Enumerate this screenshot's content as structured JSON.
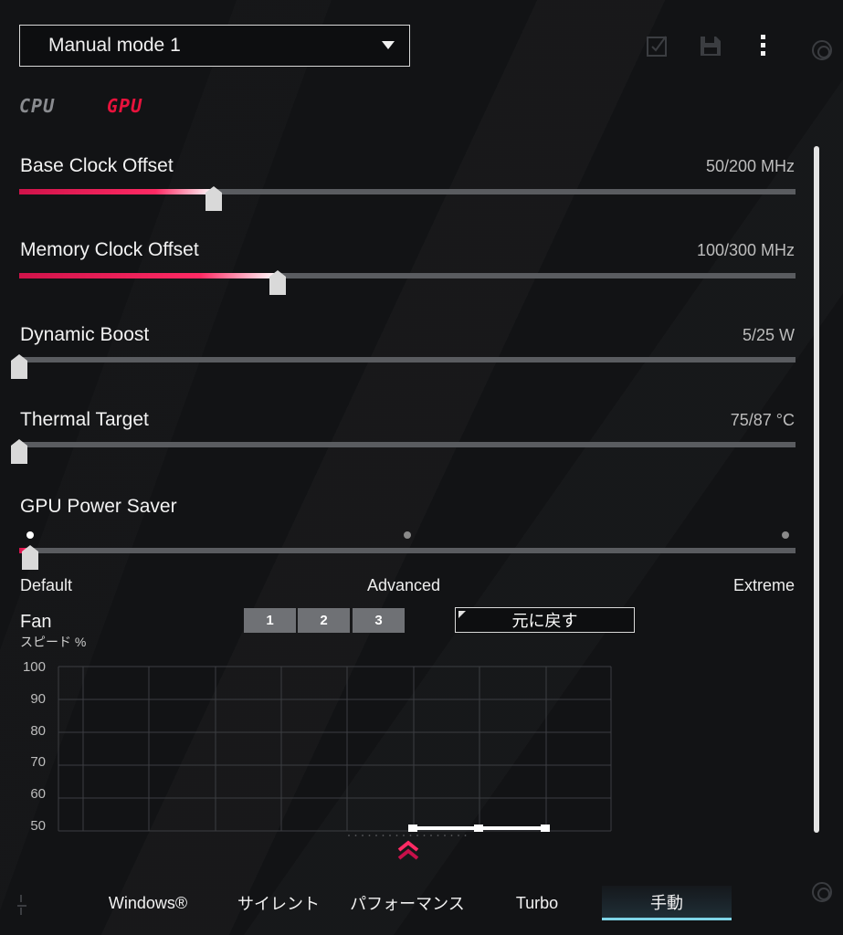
{
  "header": {
    "mode_selected": "Manual mode 1",
    "icons": [
      "apply-checkbox-icon",
      "save-disk-icon",
      "more-vertical-icon"
    ]
  },
  "device_tabs": {
    "cpu": "CPU",
    "gpu": "GPU",
    "active": "GPU"
  },
  "sliders": [
    {
      "label": "Base Clock Offset",
      "value_text": "50/200 MHz",
      "level": 0.25
    },
    {
      "label": "Memory Clock Offset",
      "value_text": "100/300 MHz",
      "level": 0.333
    },
    {
      "label": "Dynamic Boost",
      "value_text": "5/25 W",
      "level": 0
    },
    {
      "label": "Thermal Target",
      "value_text": "75/87 °C",
      "level": 0
    }
  ],
  "power_saver": {
    "label": "GPU Power Saver",
    "steps": [
      "Default",
      "Advanced",
      "Extreme"
    ],
    "selected_index": 0
  },
  "fan": {
    "title": "Fan",
    "subtitle": "スピード %",
    "fan_buttons": [
      "1",
      "2",
      "3"
    ],
    "reset_label": "元に戻す",
    "y_ticks": [
      "100",
      "90",
      "80",
      "70",
      "60",
      "50"
    ],
    "y_range": [
      50,
      100
    ],
    "curve_points_visible_at_bottom": 3
  },
  "bottom_nav": {
    "tabs": [
      "Windows®",
      "サイレント",
      "パフォーマンス",
      "Turbo",
      "手動"
    ],
    "active": "手動"
  },
  "colors": {
    "accent_red": "#e8123c",
    "accent_cyan": "#7fd5e8",
    "background": "#121315"
  }
}
